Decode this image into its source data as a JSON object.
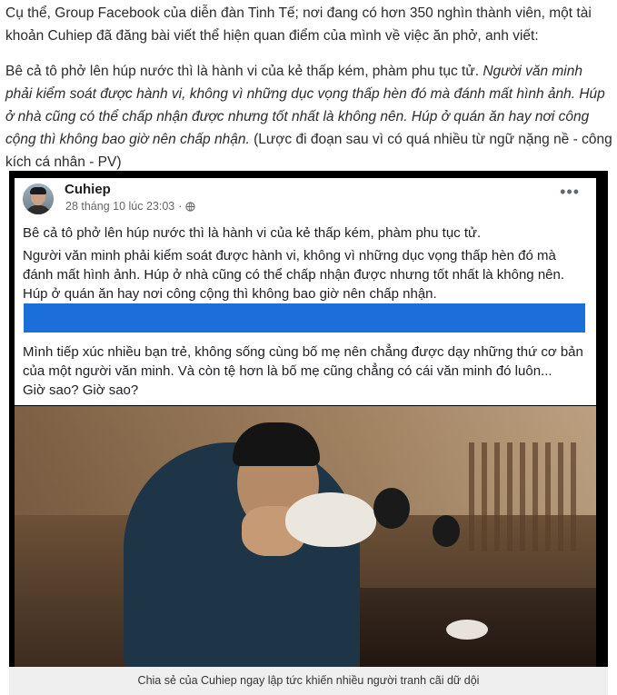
{
  "article": {
    "intro": "Cụ thể, Group Facebook của diễn đàn Tinh Tế; nơi đang có hơn 350 nghìn thành viên, một tài khoản Cuhiep đã đăng bài viết thể hiện quan điểm của mình về việc ăn phở, anh viết:",
    "quote_plain": "Bê cả tô phở lên húp nước thì là hành vi của kẻ thấp kém, phàm phu tục tử.",
    "quote_italic": "Người văn minh phải kiểm soát được hành vi, không vì những dục vọng thấp hèn đó mà đánh mất hình ảnh. Húp ở nhà cũng có thể chấp nhận được nhưng tốt nhất là không nên. Húp ở quán ăn hay nơi công cộng thì không bao giờ nên chấp nhận.",
    "editor_note": "(Lược đi đoạn sau vì có quá nhiều từ ngữ nặng nề - công kích cá nhân - PV)"
  },
  "post": {
    "author": "Cuhiep",
    "timestamp": "28 tháng 10 lúc 23:03",
    "more_icon": "more-horizontal-icon",
    "privacy_icon": "globe-icon",
    "line1": "Bê cả tô phở lên húp nước thì là hành vi của kẻ thấp kém, phàm phu tục tử.",
    "line2": "Người văn minh phải kiểm soát được hành vi, không vì những dục vọng thấp hèn đó mà đánh mất hình ảnh. Húp ở nhà cũng có thể chấp nhận được nhưng tốt nhất là không nên. Húp ở quán ăn hay nơi công cộng thì không bao giờ nên chấp nhận.",
    "line3": "Mình tiếp xúc nhiều bạn trẻ, không sống cùng bố mẹ nên chẳng được dạy những thứ cơ bản của một người văn minh. Và còn tệ hơn là bố mẹ cũng chẳng có cái văn minh đó luôn...",
    "line4": "Giờ sao? Giờ sao?",
    "redaction_color": "#1c6fd8"
  },
  "caption": "Chia sẻ của Cuhiep ngay lập tức khiến nhiều người tranh cãi dữ dội"
}
